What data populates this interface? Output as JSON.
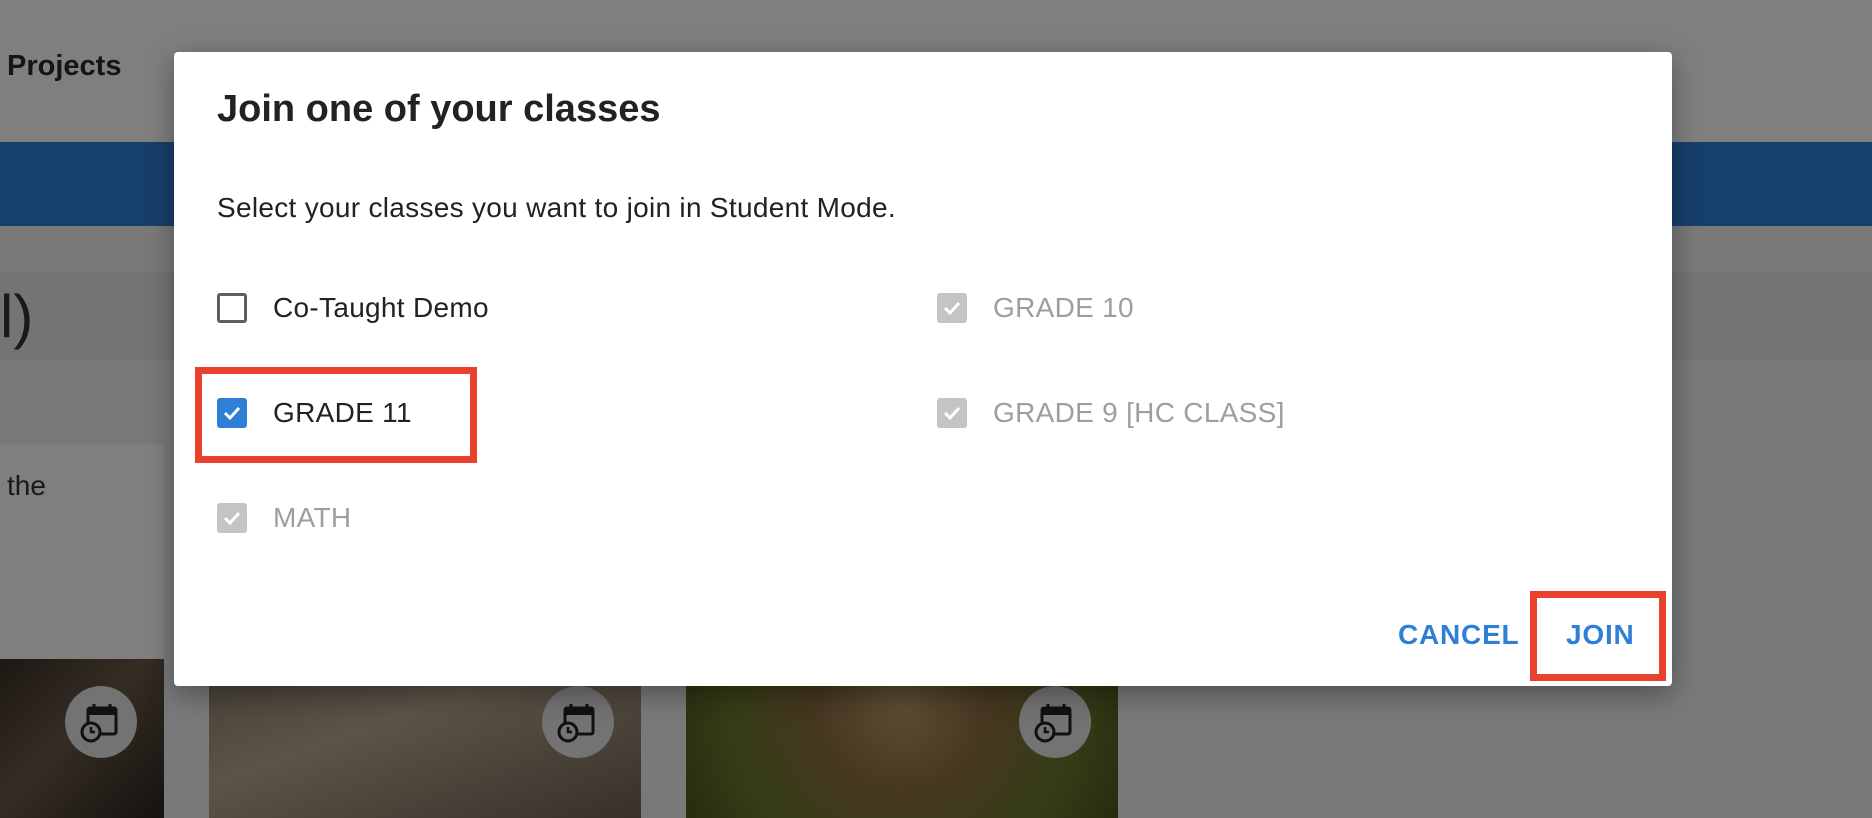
{
  "background": {
    "nav_item": "Projects",
    "partial_heading": "l)",
    "partial_card_text": "the",
    "tiles": [
      {
        "icon": "calendar-clock-icon"
      },
      {
        "icon": "calendar-clock-icon"
      },
      {
        "icon": "calendar-clock-icon"
      }
    ]
  },
  "dialog": {
    "title": "Join one of your classes",
    "description": "Select your classes you want to join in Student Mode.",
    "classes": [
      {
        "label": "Co-Taught Demo",
        "state": "unchecked"
      },
      {
        "label": "GRADE 11",
        "state": "checked"
      },
      {
        "label": "MATH",
        "state": "checked-disabled"
      },
      {
        "label": "GRADE 10",
        "state": "checked-disabled"
      },
      {
        "label": "GRADE 9 [HC CLASS]",
        "state": "checked-disabled"
      }
    ],
    "cancel_label": "CANCEL",
    "join_label": "JOIN"
  },
  "colors": {
    "accent": "#2f7fd6",
    "highlight": "#e8412c",
    "disabled": "#c4c4c4"
  }
}
